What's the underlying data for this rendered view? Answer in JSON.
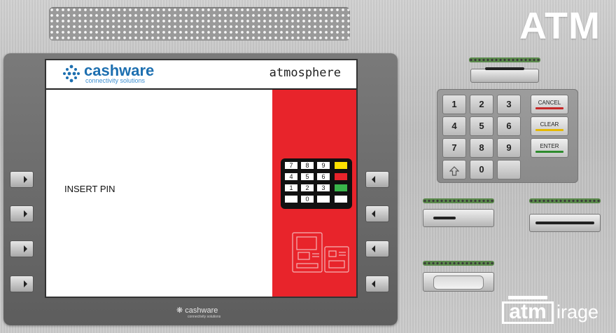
{
  "machine": {
    "title": "ATM"
  },
  "screen": {
    "brand_name": "cashware",
    "brand_tagline": "connectivity solutions",
    "product_name": "atmosphere",
    "prompt": "INSERT PIN",
    "mini_keypad": {
      "rows": [
        [
          "7",
          "8",
          "9"
        ],
        [
          "4",
          "5",
          "6"
        ],
        [
          "1",
          "2",
          "3"
        ],
        [
          "",
          "0",
          ""
        ]
      ],
      "function_colors": [
        "#ffe000",
        "#e8242b",
        "#39b54a",
        "#ffffff"
      ]
    }
  },
  "bezel": {
    "brand_name": "cashware",
    "brand_tagline": "connectivity solutions"
  },
  "keypad": {
    "rows": [
      [
        "1",
        "2",
        "3"
      ],
      [
        "4",
        "5",
        "6"
      ],
      [
        "7",
        "8",
        "9"
      ]
    ],
    "bottom_row": [
      "",
      "0",
      ""
    ],
    "shift_icon": "up-arrow-icon",
    "function_keys": [
      {
        "label": "CANCEL",
        "color": "#c62828"
      },
      {
        "label": "CLEAR",
        "color": "#e6b800"
      },
      {
        "label": "ENTER",
        "color": "#2e8b2e"
      }
    ]
  },
  "watermark": {
    "box_text": "atm",
    "rest_text": "irage"
  }
}
